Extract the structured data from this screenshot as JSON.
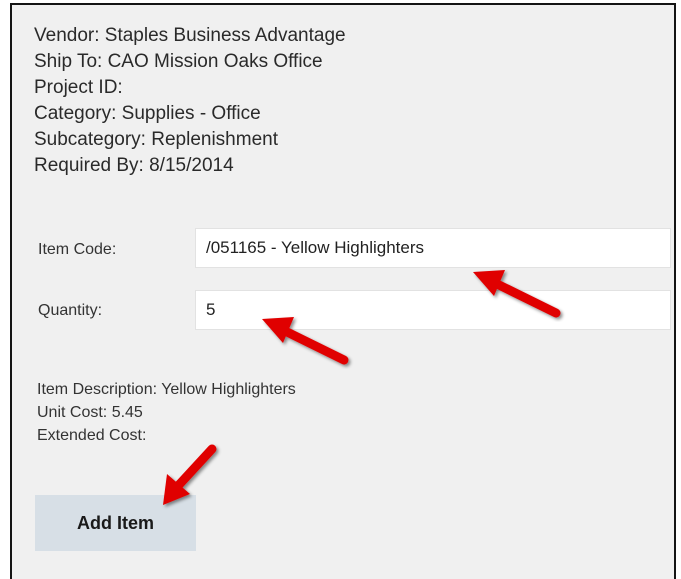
{
  "order_info": {
    "vendor": "Vendor: Staples Business Advantage",
    "ship_to": "Ship To: CAO Mission Oaks Office",
    "project_id": "Project ID:",
    "category": "Category: Supplies - Office",
    "subcategory": "Subcategory: Replenishment",
    "required_by": "Required By: 8/15/2014"
  },
  "form": {
    "item_code_label": "Item Code:",
    "item_code_value": "/051165 - Yellow Highlighters",
    "quantity_label": "Quantity:",
    "quantity_value": "5"
  },
  "item_details": {
    "description": "Item Description: Yellow Highlighters",
    "unit_cost": "Unit Cost: 5.45",
    "extended_cost": "Extended Cost:"
  },
  "actions": {
    "add_item_label": "Add Item"
  },
  "colors": {
    "panel_bg": "#f0f0f0",
    "button_bg": "#d7dfe6",
    "annotation_arrow": "#e00000"
  },
  "annotations": [
    "arrow-icon",
    "arrow-icon",
    "arrow-icon"
  ]
}
